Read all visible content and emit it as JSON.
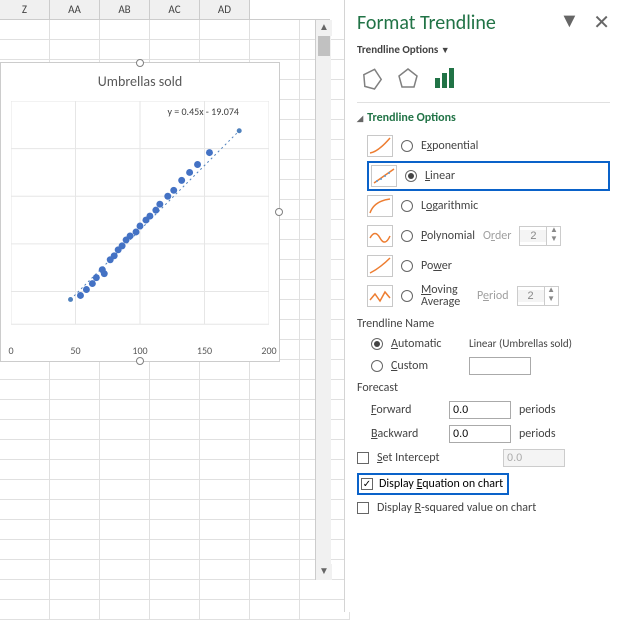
{
  "columns": [
    "Z",
    "AA",
    "AB",
    "AC",
    "AD"
  ],
  "chart": {
    "title": "Umbrellas sold",
    "equation": "y = 0.45x - 19.074",
    "xticks": [
      "0",
      "50",
      "100",
      "150",
      "200"
    ]
  },
  "chart_data": {
    "type": "scatter",
    "title": "Umbrellas sold",
    "xlabel": "",
    "ylabel": "",
    "xlim": [
      0,
      200
    ],
    "trendline": {
      "type": "linear",
      "slope": 0.45,
      "intercept": -19.074,
      "equation": "y = 0.45x - 19.074"
    },
    "points": [
      {
        "x": 65,
        "y": 11
      },
      {
        "x": 70,
        "y": 13
      },
      {
        "x": 77,
        "y": 15
      },
      {
        "x": 80,
        "y": 17
      },
      {
        "x": 85,
        "y": 20
      },
      {
        "x": 88,
        "y": 19
      },
      {
        "x": 92,
        "y": 23
      },
      {
        "x": 95,
        "y": 24
      },
      {
        "x": 98,
        "y": 26
      },
      {
        "x": 102,
        "y": 27
      },
      {
        "x": 105,
        "y": 29
      },
      {
        "x": 108,
        "y": 30
      },
      {
        "x": 112,
        "y": 31
      },
      {
        "x": 116,
        "y": 33
      },
      {
        "x": 120,
        "y": 35
      },
      {
        "x": 125,
        "y": 36
      },
      {
        "x": 128,
        "y": 38
      },
      {
        "x": 132,
        "y": 40
      },
      {
        "x": 138,
        "y": 42
      },
      {
        "x": 142,
        "y": 44
      },
      {
        "x": 148,
        "y": 47
      },
      {
        "x": 155,
        "y": 50
      },
      {
        "x": 160,
        "y": 52
      },
      {
        "x": 168,
        "y": 56
      }
    ]
  },
  "pane": {
    "title": "Format Trendline",
    "subtitle": "Trendline Options",
    "section": "Trendline Options",
    "types": {
      "exponential": "Exponential",
      "linear": "Linear",
      "logarithmic": "Logarithmic",
      "polynomial": "Polynomial",
      "power": "Power",
      "moving_average": "Moving Average"
    },
    "order_label": "Order",
    "order_value": "2",
    "period_label": "Period",
    "period_value": "2",
    "name_section": "Trendline Name",
    "automatic": "Automatic",
    "custom": "Custom",
    "auto_name": "Linear (Umbrellas sold)",
    "forecast_section": "Forecast",
    "forward": "Forward",
    "backward": "Backward",
    "fwd_value": "0.0",
    "bwd_value": "0.0",
    "periods_suffix": "periods",
    "set_intercept": "Set Intercept",
    "intercept_value": "0.0",
    "display_eq": "Display Equation on chart",
    "display_r2": "Display R-squared value on chart"
  }
}
